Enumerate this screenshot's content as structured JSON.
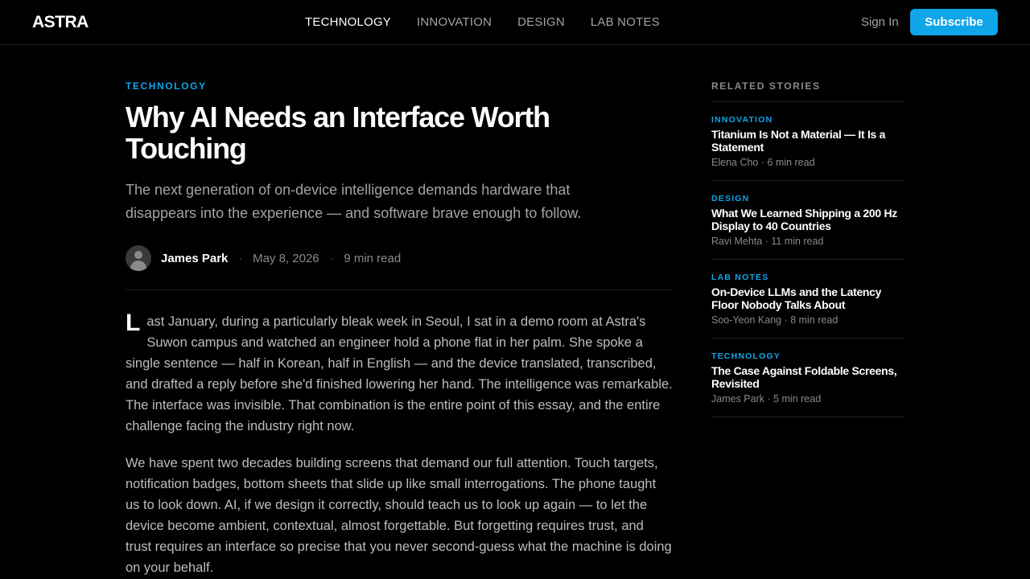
{
  "header": {
    "logo": "ASTRA",
    "nav": [
      "TECHNOLOGY",
      "INNOVATION",
      "DESIGN",
      "LAB NOTES"
    ],
    "active_nav": "TECHNOLOGY",
    "signin_label": "Sign In",
    "subscribe_label": "Subscribe"
  },
  "article": {
    "category": "TECHNOLOGY",
    "title": "Why AI Needs an Interface Worth Touching",
    "dek": "The next generation of on-device intelligence demands hardware that disappears into the experience — and software brave enough to follow.",
    "author": "James Park",
    "date": "May 8, 2026",
    "read_time": "9 min read",
    "dropcap": "L",
    "para1": "ast January, during a particularly bleak week in Seoul, I sat in a demo room at Astra's Suwon campus and watched an engineer hold a phone flat in her palm. She spoke a single sentence — half in Korean, half in English — and the device translated, transcribed, and drafted a reply before she'd finished lowering her hand. The intelligence was remarkable. The interface was invisible. That combination is the entire point of this essay, and the entire challenge facing the industry right now.",
    "para2": "We have spent two decades building screens that demand our full attention. Touch targets, notification badges, bottom sheets that slide up like small interrogations. The phone taught us to look down. AI, if we design it correctly, should teach us to look up again — to let the device become ambient, contextual, almost forgettable. But forgetting requires trust, and trust requires an interface so precise that you never second-guess what the machine is doing on your behalf."
  },
  "sidebar": {
    "title": "RELATED STORIES",
    "stories": [
      {
        "category": "INNOVATION",
        "title": "Titanium Is Not a Material — It Is a Statement",
        "meta": "Elena Cho · 6 min read"
      },
      {
        "category": "DESIGN",
        "title": "What We Learned Shipping a 200 Hz Display to 40 Countries",
        "meta": "Ravi Mehta · 11 min read"
      },
      {
        "category": "LAB NOTES",
        "title": "On-Device LLMs and the Latency Floor Nobody Talks About",
        "meta": "Soo-Yeon Kang · 8 min read"
      },
      {
        "category": "TECHNOLOGY",
        "title": "The Case Against Foldable Screens, Revisited",
        "meta": "James Park · 5 min read"
      }
    ]
  },
  "colors": {
    "accent": "#0ea5e9",
    "background": "#000000",
    "muted_text": "#a3a3a3"
  }
}
